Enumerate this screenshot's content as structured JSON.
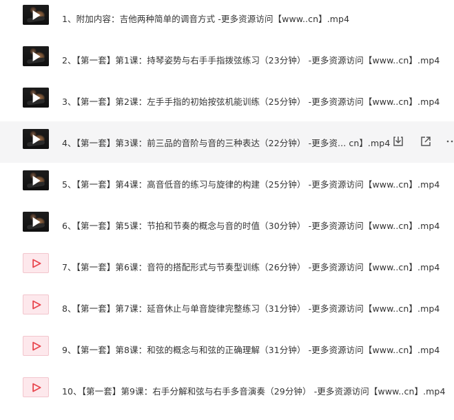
{
  "files": [
    {
      "title": "1、附加内容：吉他两种简单的调音方式 -更多资源访问【www..cn】.mp4",
      "thumb": "video"
    },
    {
      "title": "2、【第一套】第1课：持琴姿势与右手手指拨弦练习（23分钟） -更多资源访问【www..cn】.mp4",
      "thumb": "video"
    },
    {
      "title": "3、【第一套】第2课：左手手指的初始按弦机能训练（25分钟） -更多资源访问【www..cn】.mp4",
      "thumb": "video"
    },
    {
      "title": "4、【第一套】第3课：前三品的音阶与音的三种表达（22分钟） -更多资... cn】.mp4",
      "thumb": "video"
    },
    {
      "title": "5、【第一套】第4课：高音低音的练习与旋律的构建（25分钟） -更多资源访问【www..cn】.mp4",
      "thumb": "video"
    },
    {
      "title": "6、【第一套】第5课：节拍和节奏的概念与音的时值（30分钟） -更多资源访问【www..cn】.mp4",
      "thumb": "video"
    },
    {
      "title": "7、【第一套】第6课：音符的搭配形式与节奏型训练（26分钟） -更多资源访问【www..cn】.mp4",
      "thumb": "file"
    },
    {
      "title": "8、【第一套】第7课：延音休止与单音旋律完整练习（31分钟） -更多资源访问【www..cn】.mp4",
      "thumb": "file"
    },
    {
      "title": "9、【第一套】第8课：和弦的概念与和弦的正确理解（31分钟） -更多资源访问【www..cn】.mp4",
      "thumb": "file"
    },
    {
      "title": "10、【第一套】第9课：右手分解和弦与右手多音演奏（29分钟） -更多资源访问【www..cn】.mp4",
      "thumb": "file"
    }
  ],
  "hovered_row_actions": {
    "download_icon": "download-icon",
    "share_icon": "share-icon",
    "more_icon": "more-icon"
  },
  "colors": {
    "hover_background": "#f5f5f6",
    "file_icon_fill": "#fde8ec",
    "file_icon_accent": "#e8464e",
    "icon_gray": "#555555"
  }
}
